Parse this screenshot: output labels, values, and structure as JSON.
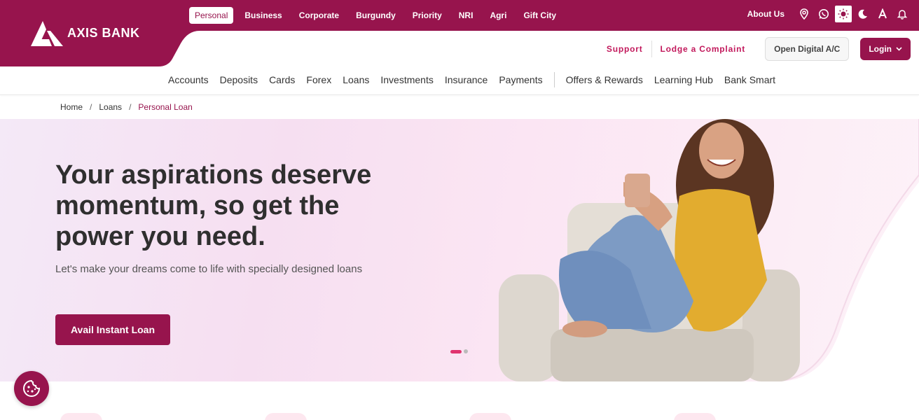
{
  "brand": {
    "name": "AXIS BANK",
    "color": "#97144d",
    "accent": "#c2185b"
  },
  "segments": [
    "Personal",
    "Business",
    "Corporate",
    "Burgundy",
    "Priority",
    "NRI",
    "Agri",
    "Gift City"
  ],
  "active_segment": "Personal",
  "top_right": {
    "about": "About Us",
    "icons": [
      "location-icon",
      "whatsapp-icon",
      "light-mode-icon",
      "dark-mode-icon",
      "font-size-icon",
      "notification-bell-icon"
    ]
  },
  "utility": {
    "support": "Support",
    "complaint": "Lodge a Complaint",
    "open_account": "Open Digital A/C",
    "login": "Login"
  },
  "main_nav": {
    "primary": [
      "Accounts",
      "Deposits",
      "Cards",
      "Forex",
      "Loans",
      "Investments",
      "Insurance",
      "Payments"
    ],
    "secondary": [
      "Offers & Rewards",
      "Learning Hub",
      "Bank Smart"
    ]
  },
  "breadcrumb": [
    "Home",
    "Loans",
    "Personal Loan"
  ],
  "hero": {
    "title": "Your aspirations deserve momentum, so get the power you need.",
    "subtitle": "Let's make your dreams come to life with specially designed loans",
    "cta": "Avail Instant Loan",
    "slide_count": 2,
    "active_slide": 1
  }
}
